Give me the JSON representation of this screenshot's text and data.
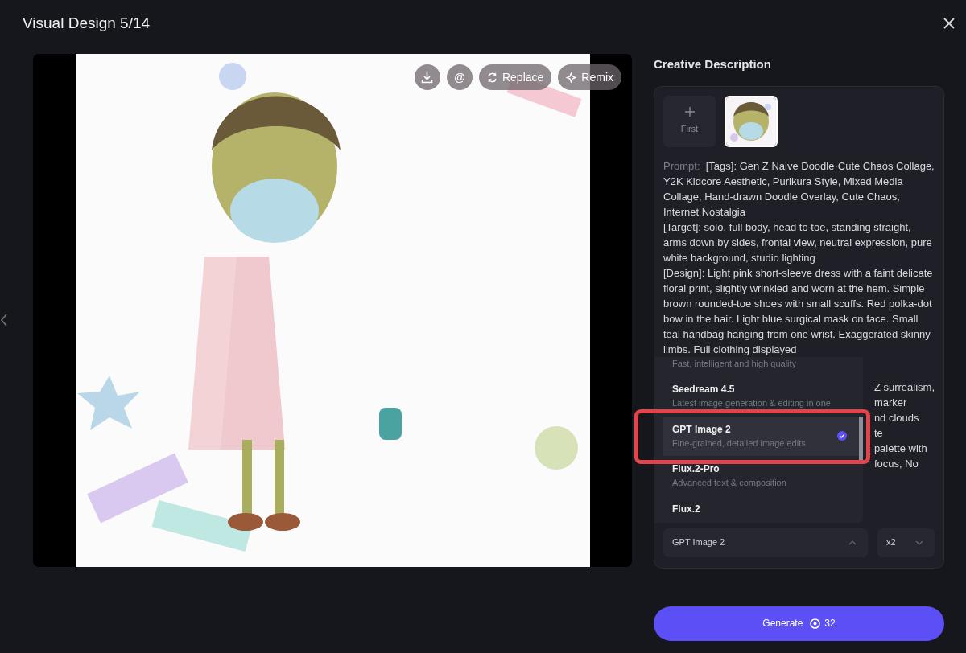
{
  "header": {
    "title": "Visual Design 5/14"
  },
  "image_toolbar": [
    {
      "kind": "download"
    },
    {
      "kind": "mention",
      "label": "@"
    },
    {
      "kind": "replace",
      "label": "Replace"
    },
    {
      "kind": "remix",
      "label": "Remix"
    }
  ],
  "panel": {
    "heading": "Creative Description",
    "add_tile": {
      "label": "First"
    },
    "prompt_label": "Prompt:",
    "prompt_paragraphs": [
      "[Tags]: Gen Z Naive Doodle·Cute Chaos Collage, Y2K Kidcore Aesthetic, Purikura Style, Mixed Media Collage, Hand-drawn Doodle Overlay, Cute Chaos, Internet Nostalgia",
      "[Target]: solo, full body, head to toe, standing straight, arms down by sides, frontal view, neutral expression, pure white background, studio lighting",
      "[Design]: Light pink short-sleeve dress with a faint delicate floral print, slightly wrinkled and worn at the hem. Simple brown rounded-toe shoes with small scuffs. Red polka-dot bow in the hair. Light blue surgical mask on face. Small teal handbag hanging from one wrist. Exaggerated skinny limbs. Full clothing displayed"
    ],
    "prompt_fragments": [
      "Z surrealism,",
      "marker",
      "nd clouds",
      "te",
      "palette with",
      "focus, No"
    ],
    "model_menu": [
      {
        "desc": "Fast, intelligent and high quality",
        "selected": false
      },
      {
        "name": "Seedream 4.5",
        "desc": "Latest image generation & editing in one",
        "selected": false
      },
      {
        "name": "GPT Image 2",
        "desc": "Fine-grained, detailed image edits",
        "selected": true
      },
      {
        "name": "Flux.2-Pro",
        "desc": "Advanced text & composition",
        "selected": false
      },
      {
        "name": "Flux.2",
        "selected": false
      }
    ],
    "model_select": {
      "value": "GPT Image 2",
      "expanded": true
    },
    "count_select": {
      "value": "x2"
    }
  },
  "generate_button": {
    "label": "Generate",
    "cost": "32"
  }
}
